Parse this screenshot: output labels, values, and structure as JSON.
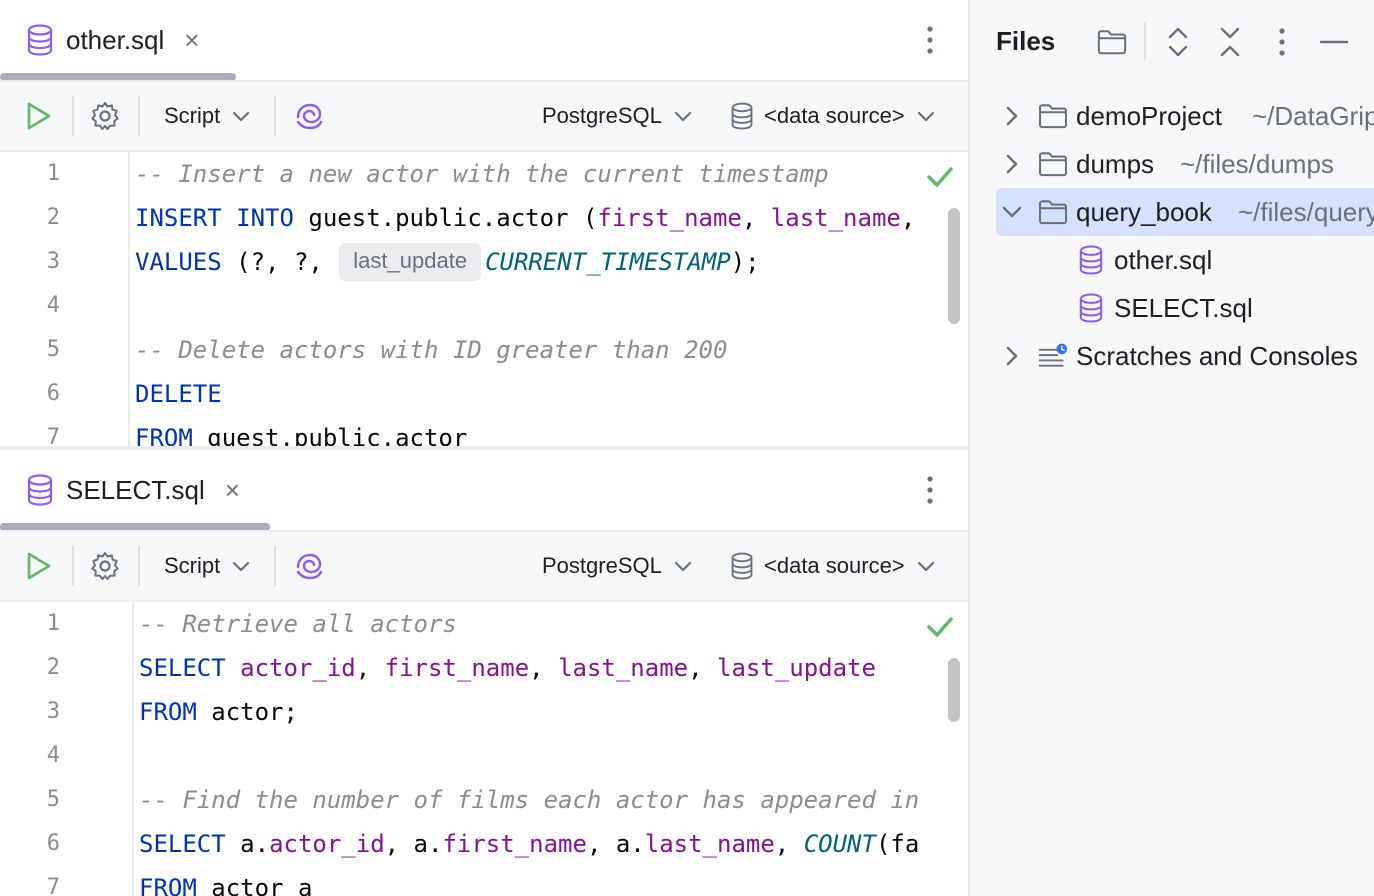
{
  "editors": {
    "top": {
      "tab_label": "other.sql",
      "toolbar": {
        "script_label": "Script",
        "dialect_label": "PostgreSQL",
        "datasource_label": "<data source>"
      },
      "lines": [
        {
          "num": "1",
          "tokens": [
            {
              "t": "-- Insert a new actor with the current timestamp",
              "c": "cmt"
            }
          ]
        },
        {
          "num": "2",
          "tokens": [
            {
              "t": "INSERT INTO",
              "c": "kw"
            },
            {
              "t": " guest.public.actor (",
              "c": "plain"
            },
            {
              "t": "first_name",
              "c": "col"
            },
            {
              "t": ", ",
              "c": "plain"
            },
            {
              "t": "last_name",
              "c": "col"
            },
            {
              "t": ",",
              "c": "plain"
            }
          ]
        },
        {
          "num": "3",
          "tokens": [
            {
              "t": "VALUES",
              "c": "kw"
            },
            {
              "t": " (?, ?, ",
              "c": "plain"
            },
            {
              "t": "last_update",
              "c": "hint"
            },
            {
              "t": "CURRENT_TIMESTAMP",
              "c": "fn"
            },
            {
              "t": ");",
              "c": "plain"
            }
          ]
        },
        {
          "num": "4",
          "tokens": []
        },
        {
          "num": "5",
          "tokens": [
            {
              "t": "-- Delete actors with ID greater than 200",
              "c": "cmt"
            }
          ]
        },
        {
          "num": "6",
          "tokens": [
            {
              "t": "DELETE",
              "c": "kw"
            }
          ]
        },
        {
          "num": "7",
          "tokens": [
            {
              "t": "FROM",
              "c": "kw"
            },
            {
              "t": " guest.public.actor",
              "c": "plain"
            }
          ]
        }
      ]
    },
    "bottom": {
      "tab_label": "SELECT.sql",
      "toolbar": {
        "script_label": "Script",
        "dialect_label": "PostgreSQL",
        "datasource_label": "<data source>"
      },
      "lines": [
        {
          "num": "1",
          "tokens": [
            {
              "t": "-- Retrieve all actors",
              "c": "cmt"
            }
          ]
        },
        {
          "num": "2",
          "tokens": [
            {
              "t": "SELECT",
              "c": "kw"
            },
            {
              "t": " ",
              "c": "plain"
            },
            {
              "t": "actor_id",
              "c": "col"
            },
            {
              "t": ", ",
              "c": "plain"
            },
            {
              "t": "first_name",
              "c": "col"
            },
            {
              "t": ", ",
              "c": "plain"
            },
            {
              "t": "last_name",
              "c": "col"
            },
            {
              "t": ", ",
              "c": "plain"
            },
            {
              "t": "last_update",
              "c": "col"
            }
          ]
        },
        {
          "num": "3",
          "tokens": [
            {
              "t": "FROM",
              "c": "kw"
            },
            {
              "t": " actor;",
              "c": "plain"
            }
          ]
        },
        {
          "num": "4",
          "tokens": []
        },
        {
          "num": "5",
          "tokens": [
            {
              "t": "-- Find the number of films each actor has appeared in",
              "c": "cmt"
            }
          ]
        },
        {
          "num": "6",
          "tokens": [
            {
              "t": "SELECT",
              "c": "kw"
            },
            {
              "t": " a.",
              "c": "plain"
            },
            {
              "t": "actor_id",
              "c": "col"
            },
            {
              "t": ", a.",
              "c": "plain"
            },
            {
              "t": "first_name",
              "c": "col"
            },
            {
              "t": ", a.",
              "c": "plain"
            },
            {
              "t": "last_name",
              "c": "col"
            },
            {
              "t": ", ",
              "c": "plain"
            },
            {
              "t": "COUNT",
              "c": "fn"
            },
            {
              "t": "(fa",
              "c": "plain"
            }
          ]
        },
        {
          "num": "7",
          "tokens": [
            {
              "t": "FROM",
              "c": "kw"
            },
            {
              "t": " actor a",
              "c": "plain"
            }
          ]
        }
      ]
    }
  },
  "files_panel": {
    "title": "Files",
    "tree": [
      {
        "name": "demoProject",
        "path": "~/DataGrip",
        "kind": "folder",
        "expanded": false,
        "selected": false
      },
      {
        "name": "dumps",
        "path": "~/files/dumps",
        "kind": "folder",
        "expanded": false,
        "selected": false
      },
      {
        "name": "query_book",
        "path": "~/files/query_book",
        "kind": "folder",
        "expanded": true,
        "selected": true
      },
      {
        "name": "other.sql",
        "path": "",
        "kind": "sql",
        "expanded": false,
        "selected": false
      },
      {
        "name": "SELECT.sql",
        "path": "",
        "kind": "sql",
        "expanded": false,
        "selected": false
      },
      {
        "name": "Scratches and Consoles",
        "path": "",
        "kind": "scratches",
        "expanded": false,
        "selected": false
      }
    ]
  },
  "colors": {
    "keyword": "#0033b3",
    "column": "#871094",
    "comment": "#8c8c8c",
    "function": "#00627a",
    "run_green": "#5fb865",
    "db_icon_purple": "#8b5cf6",
    "selection": "#d5e1ff"
  },
  "icons": {
    "run": "play-icon",
    "settings": "gear-icon",
    "ai": "ai-assistant-icon",
    "db": "database-icon",
    "folder": "folder-icon",
    "more": "vertical-ellipsis-icon"
  }
}
